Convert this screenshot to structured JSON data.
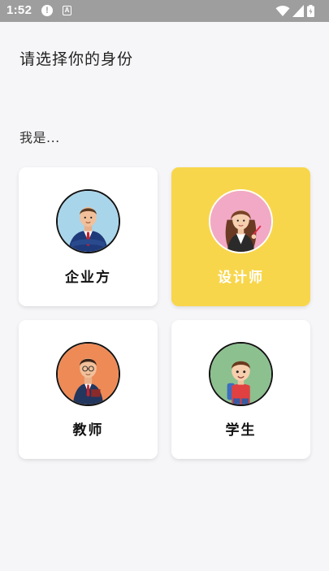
{
  "status_bar": {
    "time": "1:52",
    "alert_glyph": "!",
    "a_glyph": "A",
    "icons": [
      "alert-icon",
      "a-notification-icon",
      "wifi-icon",
      "cellular-icon",
      "battery-icon"
    ]
  },
  "page": {
    "title": "请选择你的身份",
    "prompt": "我是..."
  },
  "roles": [
    {
      "label": "企业方",
      "selected": false,
      "avatar_bg": "#a9d5ea",
      "icon": "businessman-avatar-icon"
    },
    {
      "label": "设计师",
      "selected": true,
      "avatar_bg": "#f1a9c6",
      "icon": "designer-avatar-icon"
    },
    {
      "label": "教师",
      "selected": false,
      "avatar_bg": "#ee8a56",
      "icon": "teacher-avatar-icon"
    },
    {
      "label": "学生",
      "selected": false,
      "avatar_bg": "#8cc08f",
      "icon": "student-avatar-icon"
    }
  ],
  "colors": {
    "accent": "#f8d64c",
    "background": "#f6f6f8",
    "status_bar": "#9e9e9e"
  }
}
